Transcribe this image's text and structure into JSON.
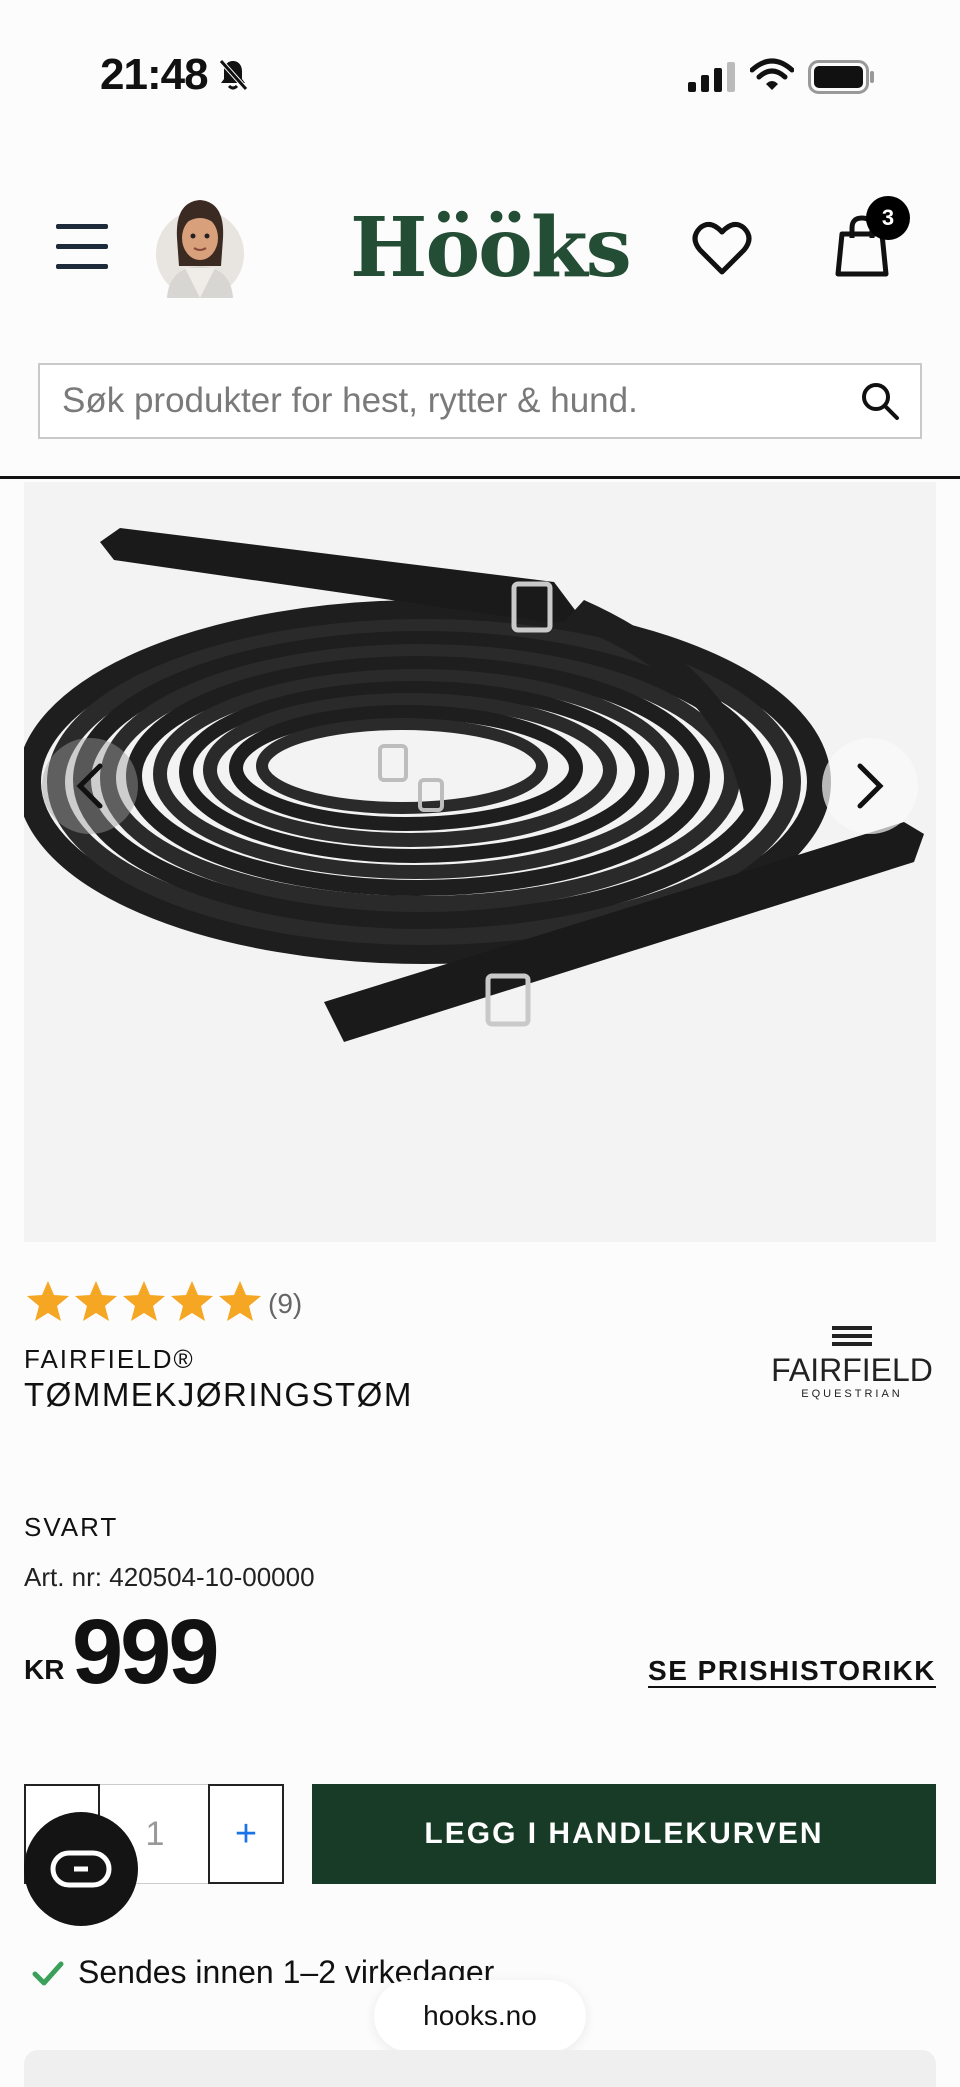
{
  "status_bar": {
    "time": "21:48"
  },
  "header": {
    "logo": "Hööks",
    "cart_count": "3"
  },
  "search": {
    "placeholder": "Søk produkter for hest, rytter & hund."
  },
  "product": {
    "rating": 5,
    "rating_count": "(9)",
    "brand": "FAIRFIELD®",
    "title": "TØMMEKJØRINGSTØM",
    "brand_logo_name": "FAIRFIELD",
    "brand_logo_sub": "EQUESTRIAN",
    "color": "SVART",
    "article_number": "Art. nr: 420504-10-00000",
    "currency": "KR",
    "price": "999",
    "price_history_label": "SE PRISHISTORIKK"
  },
  "cart": {
    "quantity": "1",
    "minus_label": "–",
    "plus_label": "+",
    "add_to_cart_label": "LEGG I HANDLEKURVEN"
  },
  "shipping": {
    "text": "Sendes innen 1–2 virkedager"
  },
  "browser": {
    "url": "hooks.no"
  },
  "colors": {
    "brand_green": "#234d34",
    "button_green": "#173b27",
    "star": "#f5a623"
  },
  "icons": [
    "bell-slash-icon",
    "signal-icon",
    "wifi-icon",
    "battery-icon",
    "menu-icon",
    "heart-icon",
    "shopping-bag-icon",
    "search-icon",
    "chevron-left-icon",
    "chevron-right-icon",
    "star-icon",
    "checkmark-icon",
    "chat-icon"
  ]
}
